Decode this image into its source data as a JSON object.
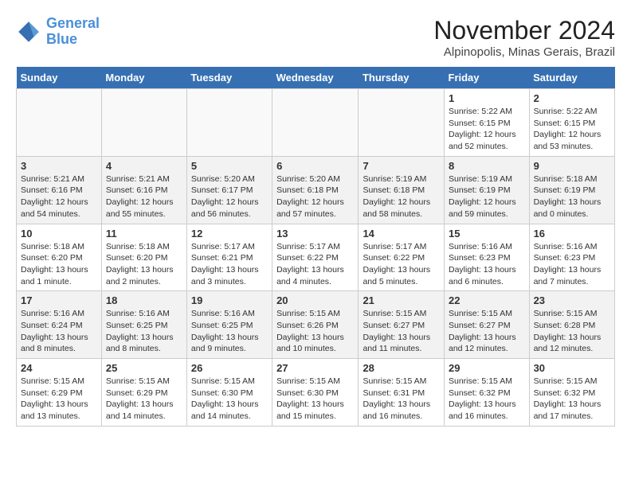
{
  "header": {
    "logo_line1": "General",
    "logo_line2": "Blue",
    "month": "November 2024",
    "location": "Alpinopolis, Minas Gerais, Brazil"
  },
  "days_of_week": [
    "Sunday",
    "Monday",
    "Tuesday",
    "Wednesday",
    "Thursday",
    "Friday",
    "Saturday"
  ],
  "weeks": [
    [
      {
        "day": "",
        "info": ""
      },
      {
        "day": "",
        "info": ""
      },
      {
        "day": "",
        "info": ""
      },
      {
        "day": "",
        "info": ""
      },
      {
        "day": "",
        "info": ""
      },
      {
        "day": "1",
        "info": "Sunrise: 5:22 AM\nSunset: 6:15 PM\nDaylight: 12 hours and 52 minutes."
      },
      {
        "day": "2",
        "info": "Sunrise: 5:22 AM\nSunset: 6:15 PM\nDaylight: 12 hours and 53 minutes."
      }
    ],
    [
      {
        "day": "3",
        "info": "Sunrise: 5:21 AM\nSunset: 6:16 PM\nDaylight: 12 hours and 54 minutes."
      },
      {
        "day": "4",
        "info": "Sunrise: 5:21 AM\nSunset: 6:16 PM\nDaylight: 12 hours and 55 minutes."
      },
      {
        "day": "5",
        "info": "Sunrise: 5:20 AM\nSunset: 6:17 PM\nDaylight: 12 hours and 56 minutes."
      },
      {
        "day": "6",
        "info": "Sunrise: 5:20 AM\nSunset: 6:18 PM\nDaylight: 12 hours and 57 minutes."
      },
      {
        "day": "7",
        "info": "Sunrise: 5:19 AM\nSunset: 6:18 PM\nDaylight: 12 hours and 58 minutes."
      },
      {
        "day": "8",
        "info": "Sunrise: 5:19 AM\nSunset: 6:19 PM\nDaylight: 12 hours and 59 minutes."
      },
      {
        "day": "9",
        "info": "Sunrise: 5:18 AM\nSunset: 6:19 PM\nDaylight: 13 hours and 0 minutes."
      }
    ],
    [
      {
        "day": "10",
        "info": "Sunrise: 5:18 AM\nSunset: 6:20 PM\nDaylight: 13 hours and 1 minute."
      },
      {
        "day": "11",
        "info": "Sunrise: 5:18 AM\nSunset: 6:20 PM\nDaylight: 13 hours and 2 minutes."
      },
      {
        "day": "12",
        "info": "Sunrise: 5:17 AM\nSunset: 6:21 PM\nDaylight: 13 hours and 3 minutes."
      },
      {
        "day": "13",
        "info": "Sunrise: 5:17 AM\nSunset: 6:22 PM\nDaylight: 13 hours and 4 minutes."
      },
      {
        "day": "14",
        "info": "Sunrise: 5:17 AM\nSunset: 6:22 PM\nDaylight: 13 hours and 5 minutes."
      },
      {
        "day": "15",
        "info": "Sunrise: 5:16 AM\nSunset: 6:23 PM\nDaylight: 13 hours and 6 minutes."
      },
      {
        "day": "16",
        "info": "Sunrise: 5:16 AM\nSunset: 6:23 PM\nDaylight: 13 hours and 7 minutes."
      }
    ],
    [
      {
        "day": "17",
        "info": "Sunrise: 5:16 AM\nSunset: 6:24 PM\nDaylight: 13 hours and 8 minutes."
      },
      {
        "day": "18",
        "info": "Sunrise: 5:16 AM\nSunset: 6:25 PM\nDaylight: 13 hours and 8 minutes."
      },
      {
        "day": "19",
        "info": "Sunrise: 5:16 AM\nSunset: 6:25 PM\nDaylight: 13 hours and 9 minutes."
      },
      {
        "day": "20",
        "info": "Sunrise: 5:15 AM\nSunset: 6:26 PM\nDaylight: 13 hours and 10 minutes."
      },
      {
        "day": "21",
        "info": "Sunrise: 5:15 AM\nSunset: 6:27 PM\nDaylight: 13 hours and 11 minutes."
      },
      {
        "day": "22",
        "info": "Sunrise: 5:15 AM\nSunset: 6:27 PM\nDaylight: 13 hours and 12 minutes."
      },
      {
        "day": "23",
        "info": "Sunrise: 5:15 AM\nSunset: 6:28 PM\nDaylight: 13 hours and 12 minutes."
      }
    ],
    [
      {
        "day": "24",
        "info": "Sunrise: 5:15 AM\nSunset: 6:29 PM\nDaylight: 13 hours and 13 minutes."
      },
      {
        "day": "25",
        "info": "Sunrise: 5:15 AM\nSunset: 6:29 PM\nDaylight: 13 hours and 14 minutes."
      },
      {
        "day": "26",
        "info": "Sunrise: 5:15 AM\nSunset: 6:30 PM\nDaylight: 13 hours and 14 minutes."
      },
      {
        "day": "27",
        "info": "Sunrise: 5:15 AM\nSunset: 6:30 PM\nDaylight: 13 hours and 15 minutes."
      },
      {
        "day": "28",
        "info": "Sunrise: 5:15 AM\nSunset: 6:31 PM\nDaylight: 13 hours and 16 minutes."
      },
      {
        "day": "29",
        "info": "Sunrise: 5:15 AM\nSunset: 6:32 PM\nDaylight: 13 hours and 16 minutes."
      },
      {
        "day": "30",
        "info": "Sunrise: 5:15 AM\nSunset: 6:32 PM\nDaylight: 13 hours and 17 minutes."
      }
    ]
  ]
}
